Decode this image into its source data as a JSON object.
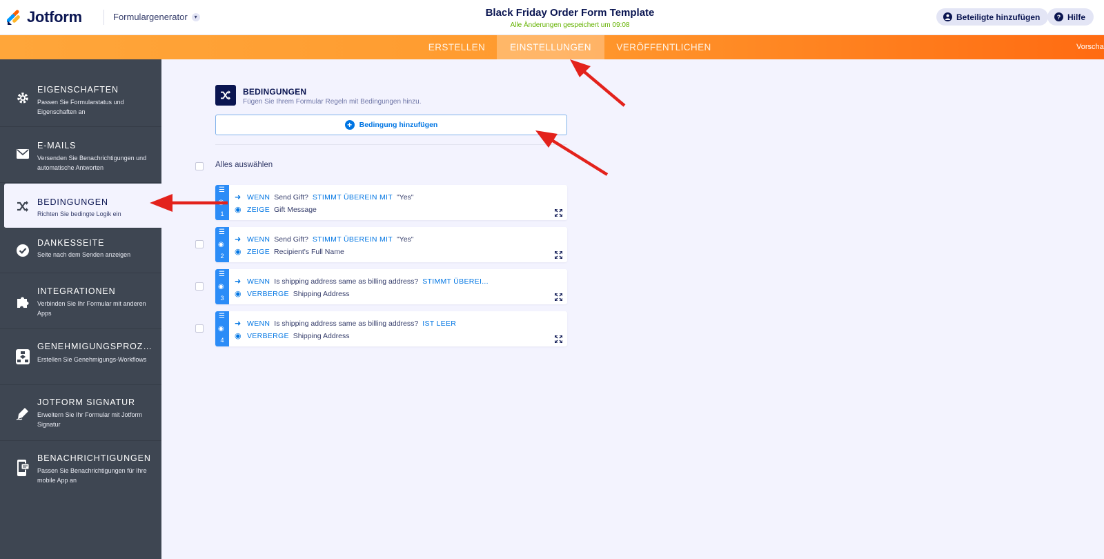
{
  "header": {
    "brand": "Jotform",
    "form_generator": "Formulargenerator",
    "form_title": "Black Friday Order Form Template",
    "saved_status": "Alle Änderungen gespeichert um 09:08",
    "add_participants": "Beteiligte hinzufügen",
    "help": "Hilfe"
  },
  "nav": {
    "tabs": [
      {
        "label": "ERSTELLEN",
        "active": false
      },
      {
        "label": "EINSTELLUNGEN",
        "active": true
      },
      {
        "label": "VERÖFFENTLICHEN",
        "active": false
      }
    ],
    "preview": "Vorscha"
  },
  "sidebar": {
    "items": [
      {
        "title": "EIGENSCHAFTEN",
        "desc": "Passen Sie Formularstatus und Eigenschaften an",
        "icon": "gear-icon"
      },
      {
        "title": "E-MAILS",
        "desc": "Versenden Sie Benachrichtigungen und automatische Antworten",
        "icon": "envelope-icon"
      },
      {
        "title": "BEDINGUNGEN",
        "desc": "Richten Sie bedingte Logik ein",
        "icon": "shuffle-icon",
        "active": true
      },
      {
        "title": "DANKESSEITE",
        "desc": "Seite nach dem Senden anzeigen",
        "icon": "check-circle-icon"
      },
      {
        "title": "INTEGRATIONEN",
        "desc": "Verbinden Sie Ihr Formular mit anderen Apps",
        "icon": "puzzle-icon"
      },
      {
        "title": "GENEHMIGUNGSPROZES...",
        "desc": "Erstellen Sie Genehmigungs-Workflows",
        "icon": "workflow-icon"
      },
      {
        "title": "JOTFORM SIGNATUR",
        "desc": "Erweitern Sie Ihr Formular mit Jotform Signatur",
        "icon": "pen-icon"
      },
      {
        "title": "BENACHRICHTIGUNGEN",
        "desc": "Passen Sie Benachrichtigungen für Ihre mobile App an",
        "icon": "mobile-notification-icon"
      }
    ]
  },
  "conditions": {
    "title": "BEDINGUNGEN",
    "description": "Fügen Sie Ihrem Formular Regeln mit Bedingungen hinzu.",
    "add_button": "Bedingung hinzufügen",
    "select_all": "Alles auswählen",
    "items": [
      {
        "number": "1",
        "if_kw": "WENN",
        "field": "Send Gift?",
        "op": "STIMMT ÜBEREIN MIT",
        "value": "\"Yes\"",
        "action_kw": "ZEIGE",
        "target": "Gift Message"
      },
      {
        "number": "2",
        "if_kw": "WENN",
        "field": "Send Gift?",
        "op": "STIMMT ÜBEREIN MIT",
        "value": "\"Yes\"",
        "action_kw": "ZEIGE",
        "target": "Recipient's Full Name"
      },
      {
        "number": "3",
        "if_kw": "WENN",
        "field": "Is shipping address same as billing address?",
        "op": "STIMMT ÜBEREI...",
        "value": "",
        "action_kw": "VERBERGE",
        "target": "Shipping Address"
      },
      {
        "number": "4",
        "if_kw": "WENN",
        "field": "Is shipping address same as billing address?",
        "op": "IST LEER",
        "value": "",
        "action_kw": "VERBERGE",
        "target": "Shipping Address"
      }
    ]
  },
  "colors": {
    "brand_navy": "#0a1551",
    "accent_blue": "#0075e3",
    "nav_orange": "#ff9a2e",
    "sidebar": "#3e4652",
    "annotation_red": "#e3221c"
  }
}
